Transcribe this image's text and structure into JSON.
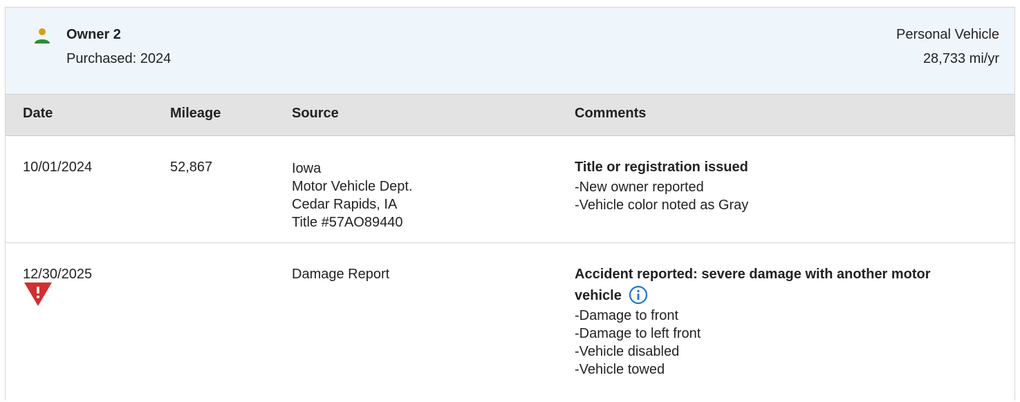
{
  "owner": {
    "name": "Owner 2",
    "purchased": "Purchased: 2024",
    "vehicle_type": "Personal Vehicle",
    "annual_mileage": "28,733 mi/yr",
    "icon": "person-icon",
    "icon_colors": {
      "head": "#d4a017",
      "body": "#2e8b3a"
    }
  },
  "table": {
    "headers": {
      "date": "Date",
      "mileage": "Mileage",
      "source": "Source",
      "comments": "Comments"
    },
    "rows": [
      {
        "date": "10/01/2024",
        "mileage": "52,867",
        "source": [
          "Iowa",
          "Motor Vehicle Dept.",
          "Cedar Rapids, IA",
          "Title #57AO89440"
        ],
        "comment_title": "Title or registration issued",
        "comment_items": [
          "-New owner reported",
          "-Vehicle color noted as Gray"
        ]
      },
      {
        "date": "12/30/2025",
        "mileage": "",
        "source": [
          "Damage Report"
        ],
        "comment_title_line1": "Accident reported: severe damage with another motor",
        "comment_title_line2": "vehicle",
        "comment_items": [
          "-Damage to front",
          "-Damage to left front",
          "-Vehicle disabled",
          "-Vehicle towed"
        ],
        "alert_icon": "warning-triangle-icon",
        "info_icon": "info-icon"
      }
    ]
  },
  "colors": {
    "header_bg": "#eef5fb",
    "table_head_bg": "#e3e3e3",
    "warning": "#d32f2f",
    "info": "#1976d2"
  }
}
